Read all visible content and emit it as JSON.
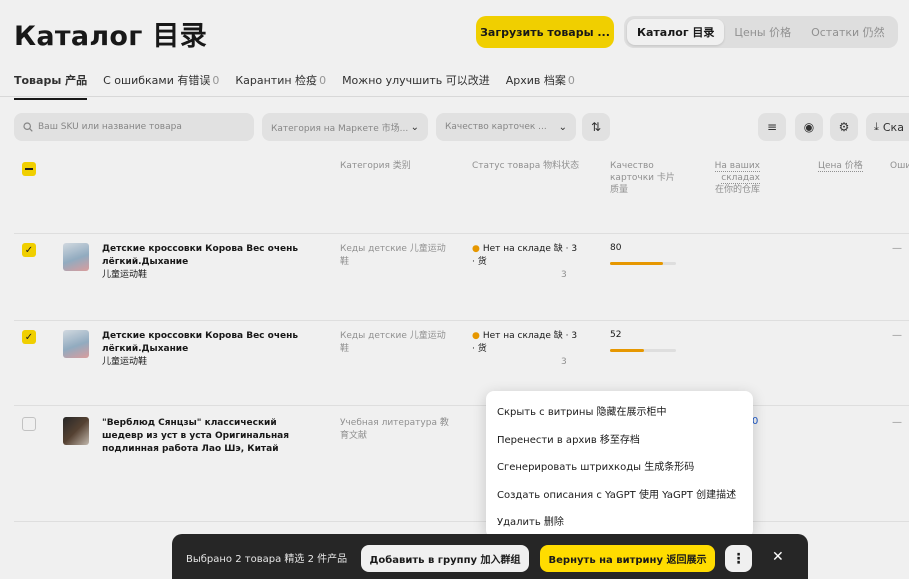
{
  "header": {
    "title": "Каталог 目录",
    "upload_button": "Загрузить товары ...",
    "segments": [
      "Каталог 目录",
      "Цены 价格",
      "Остатки 仍然"
    ]
  },
  "tabs": [
    {
      "label": "Товары 产品",
      "count": ""
    },
    {
      "label": "С ошибками 有错误",
      "count": "0"
    },
    {
      "label": "Карантин 检疫",
      "count": "0"
    },
    {
      "label": "Можно улучшить 可以改进",
      "count": ""
    },
    {
      "label": "Архив 档案",
      "count": "0"
    }
  ],
  "filters": {
    "search_placeholder": "Ваш SKU или название товара",
    "category_select": "Категория на Маркете 市场...",
    "quality_select": "Качество карточек ...",
    "export_label": "Ска"
  },
  "columns": {
    "category": "Категория 类别",
    "status": "Статус товара 物料状态",
    "quality": "Качество карточки 卡片质量",
    "warehouse": "На ваших складах",
    "warehouse_cn": "在你的仓库",
    "price": "Цена 价格",
    "errors": "Оши"
  },
  "rows": [
    {
      "name": "Детские кроссовки Корова Вес очень лёгкий.Дыхание",
      "name_cn": "儿童运动鞋",
      "category": "Кеды детские 儿童运动鞋",
      "status": "Нет на складе 缺 · 3 · 货",
      "status_sub": "3",
      "quality": "80",
      "quality_pct": 0.8,
      "checked": true,
      "errors": "—"
    },
    {
      "name": "Детские кроссовки Корова Вес очень лёгкий.Дыхание",
      "name_cn": "儿童运动鞋",
      "category": "Кеды детские 儿童运动鞋",
      "status": "Нет на складе 缺 · 3 · 货",
      "status_sub": "3",
      "quality": "52",
      "quality_pct": 0.52,
      "checked": true,
      "errors": "—"
    },
    {
      "name": "\"Верблюд Сянцзы\" классический шедевр из уст в уста Оригинальная подлинная работа Лао Шэ, Китай",
      "category": "Учебная литература 教育文献",
      "checked": false,
      "link_value": "0",
      "errors": "—"
    }
  ],
  "context_menu": [
    "Скрыть с витрины 隐藏在展示柜中",
    "Перенести в архив 移至存档",
    "Сгенерировать штрихкоды 生成条形码",
    "Создать описания с YaGPT 使用 YaGPT 创建描述",
    "Удалить 删除"
  ],
  "action_bar": {
    "selected": "Выбрано 2 товара 精选 2 件产品",
    "add_group": "Добавить в группу 加入群组",
    "return": "Вернуть на витрину 返回展示",
    "more": "⋮",
    "close": "✕"
  },
  "colors": {
    "accent": "#ffdc00",
    "status_dot": "#f5a100",
    "link": "#1f5fd6",
    "bar_bg": "#262626"
  }
}
